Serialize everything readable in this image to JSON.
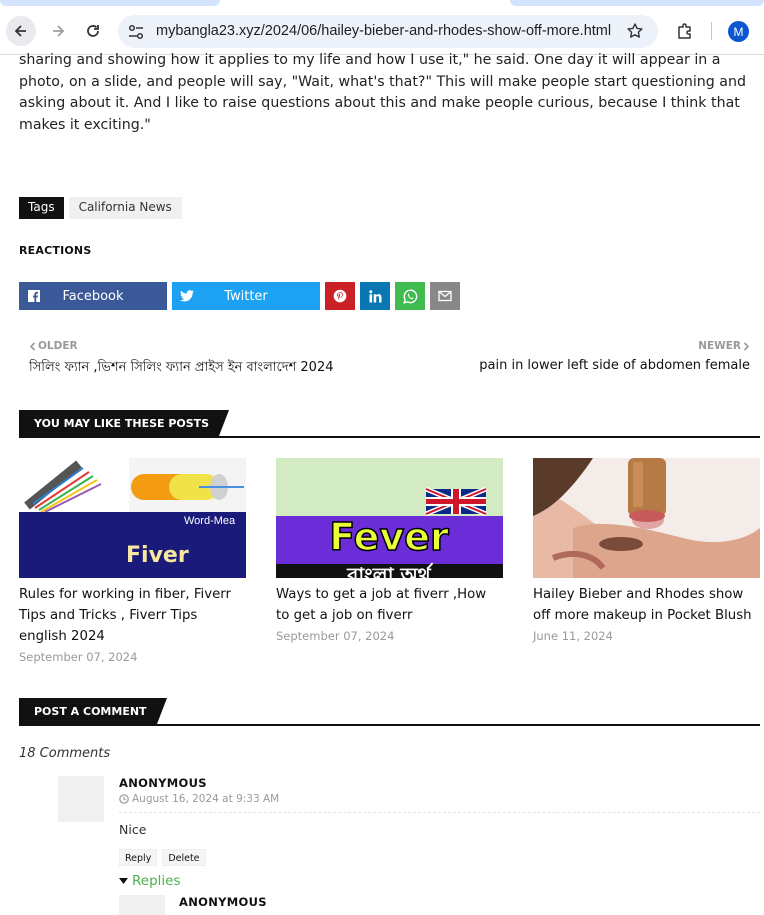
{
  "browser": {
    "url": "mybangla23.xyz/2024/06/hailey-bieber-and-rhodes-show-off-more.html",
    "profile_initial": "M",
    "icons": [
      "back-icon",
      "forward-icon",
      "reload-icon",
      "site-settings-icon",
      "bookmark-star-icon",
      "extensions-icon"
    ]
  },
  "article": {
    "paragraph": "sharing and showing how it applies to my life and how I use it,\" he said. One day it will appear in a photo, on a slide, and people will say, \"Wait, what's that?\" This will make people start questioning and asking about it. And I like to raise questions about this and make people curious, because I think that makes it exciting.\""
  },
  "tags": {
    "label": "Tags",
    "items": [
      "California News"
    ]
  },
  "reactions": {
    "heading": "REACTIONS"
  },
  "share": {
    "facebook": "Facebook",
    "twitter": "Twitter",
    "colors": {
      "facebook": "#3b5998",
      "twitter": "#1da1f2",
      "pinterest": "#ca2127",
      "linkedin": "#0976b4",
      "whatsapp": "#3fbb50",
      "email": "#888888"
    }
  },
  "pager": {
    "older_label": "OLDER",
    "older_title": "সিলিং ফ্যান ,ভিশন সিলিং ফ্যান প্রাইস ইন বাংলাদেশ 2024",
    "newer_label": "NEWER",
    "newer_title": "pain in lower left side of abdomen female"
  },
  "related": {
    "heading": "YOU MAY LIKE THESE POSTS",
    "posts": [
      {
        "title": "Rules for working in fiber, Fiverr Tips and Tricks , Fiverr Tips english 2024",
        "date": "September 07, 2024",
        "thumb_text_1": "Word-Mea",
        "thumb_text_2": "Fiver"
      },
      {
        "title": "Ways to get a job at fiverr ,How to get a job on fiverr",
        "date": "September 07, 2024",
        "thumb_text_1": "Fever",
        "thumb_text_2": "বাংলা অর্থ"
      },
      {
        "title": "Hailey Bieber and Rhodes show off more makeup in Pocket Blush",
        "date": "June 11, 2024"
      }
    ]
  },
  "comments": {
    "heading": "POST A COMMENT",
    "count_label": "18 Comments",
    "first": {
      "author": "ANONYMOUS",
      "date": "August 16, 2024 at 9:33 AM",
      "body": "Nice",
      "reply": "Reply",
      "delete": "Delete",
      "replies_label": "Replies"
    },
    "reply": {
      "author": "ANONYMOUS"
    }
  }
}
